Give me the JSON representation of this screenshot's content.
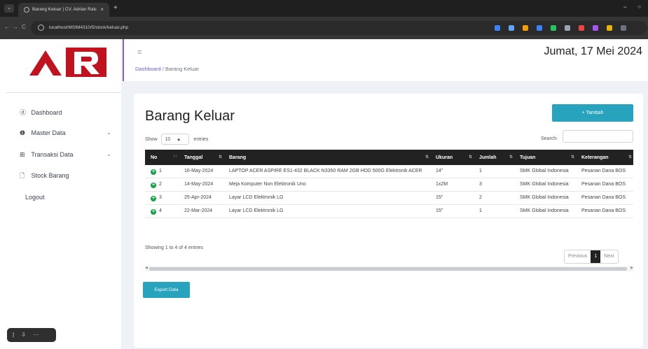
{
  "browser": {
    "menu_glyph": "⌄",
    "tab_title": "Barang Keluar | CV. Adrian Ratu",
    "tab_close": "×",
    "new_tab": "+",
    "back": "←",
    "forward": "→",
    "reload": "C",
    "url": "localhost/MSIM4310/5/stock/keluar.php",
    "minimize": "−",
    "restore": "○",
    "extension_colors": [
      "#3b82f6",
      "#60a5fa",
      "#f59e0b",
      "#3b82f6",
      "#22c55e",
      "#9ca3af",
      "#ef4444",
      "#a855f7",
      "#eab308",
      "#6b7280"
    ]
  },
  "sidebar": {
    "logo_text": "AR",
    "logo_color": "#c1121f",
    "items": [
      {
        "icon": "ⓓ",
        "label": "Dashboard"
      },
      {
        "icon": "❶",
        "label": "Master Data",
        "chevron": "⌄"
      },
      {
        "icon": "⊞",
        "label": "Transaksi Data",
        "chevron": "⌄"
      },
      {
        "icon": "🗋",
        "label": "Stock Barang"
      }
    ],
    "logout": "Logout"
  },
  "floating_toolbar": "| ⇩ ···",
  "topbar": {
    "hamburger": "≡",
    "date": "Jumat, 17 Mei 2024",
    "breadcrumb_link": "Dashboard",
    "breadcrumb_sep": " / ",
    "breadcrumb_current": "Barang Keluar"
  },
  "card": {
    "title": "Barang Keluar",
    "add_button": "+ Tambah",
    "show_label": "Show",
    "page_length": "10",
    "length_arrow": "◆",
    "entries_label": "entries",
    "search_label": "Search:",
    "columns": [
      "No",
      "Tanggal",
      "Barang",
      "Ukuran",
      "Jumlah",
      "Tujuan",
      "Keterangan"
    ],
    "sort_glyph_first": "↑↑",
    "sort_glyph": "⇅",
    "rows": [
      {
        "no": "1",
        "tanggal": "16-May-2024",
        "barang": "LAPTOP ACER ASPIRE ES1-432 BLACK N3350 RAM 2GB HDD 500G Elektronik ACER",
        "ukuran": "14\"",
        "jumlah": "1",
        "tujuan": "SMK Global Indonesia",
        "keterangan": "Pesanan Dana BOS"
      },
      {
        "no": "2",
        "tanggal": "14-May-2024",
        "barang": "Meja Komputer Non Elektronik Uno",
        "ukuran": "1x2M",
        "jumlah": "3",
        "tujuan": "SMK Global Indonesia",
        "keterangan": "Pesanan Dana BOS"
      },
      {
        "no": "3",
        "tanggal": "25-Apr-2024",
        "barang": "Layar LCD Elektronik LG",
        "ukuran": "15\"",
        "jumlah": "2",
        "tujuan": "SMK Global Indonesia",
        "keterangan": "Pesanan Dana BOS"
      },
      {
        "no": "4",
        "tanggal": "22-Mar-2024",
        "barang": "Layar LCD Elektronik LG",
        "ukuran": "15\"",
        "jumlah": "1",
        "tujuan": "SMK Global Indonesia",
        "keterangan": "Pesanan Dana BOS"
      }
    ],
    "showing": "Showing 1 to 4 of 4 entries",
    "previous": "Previous",
    "current_page": "1",
    "next": "Next",
    "export_button": "Export Data"
  },
  "colors": {
    "accent": "#27a3bd",
    "table_header": "#222222",
    "plus_green": "#16a34a",
    "breadcrumb_link": "#6d5ad6"
  }
}
